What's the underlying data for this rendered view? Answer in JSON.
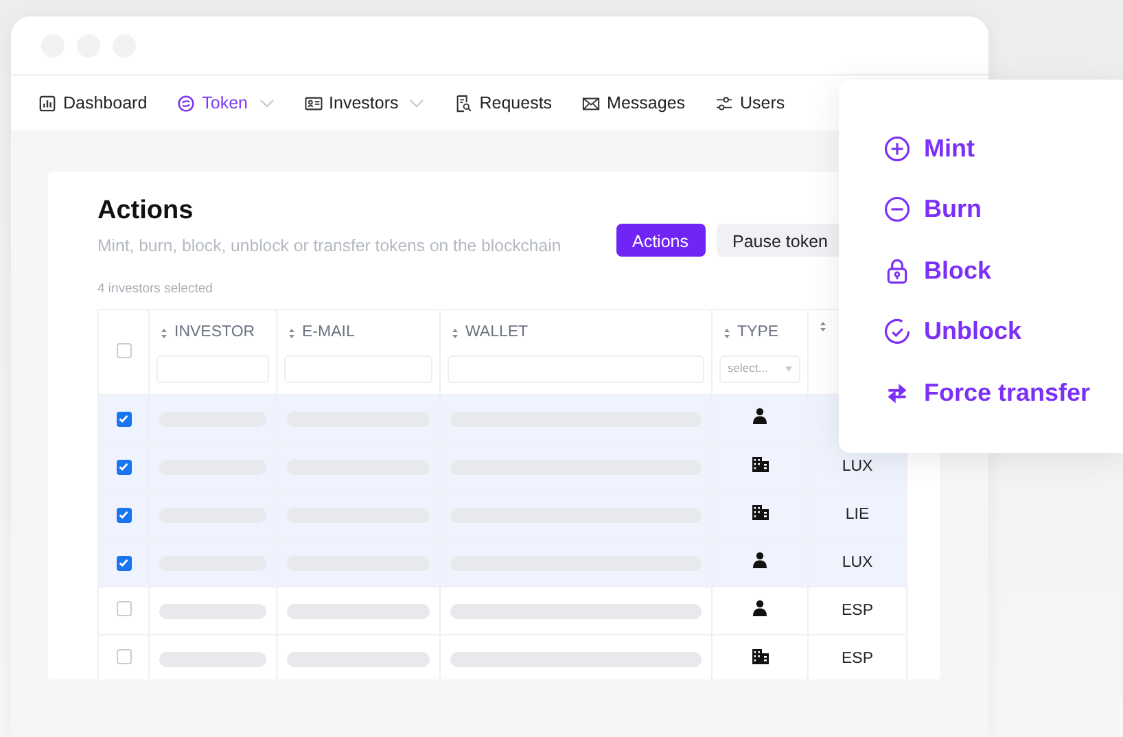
{
  "nav": [
    {
      "label": "Dashboard",
      "kind": "chart",
      "selected": false,
      "has_menu": false
    },
    {
      "label": "Token",
      "kind": "token",
      "selected": true,
      "has_menu": true
    },
    {
      "label": "Investors",
      "kind": "card",
      "selected": false,
      "has_menu": true
    },
    {
      "label": "Requests",
      "kind": "doc",
      "selected": false,
      "has_menu": false
    },
    {
      "label": "Messages",
      "kind": "mail",
      "selected": false,
      "has_menu": false
    },
    {
      "label": "Users",
      "kind": "sliders",
      "selected": false,
      "has_menu": false
    }
  ],
  "panel": {
    "title": "Actions",
    "subtitle": "Mint, burn, block, unblock or transfer tokens on the blockchain",
    "selection_note": "4 investors selected",
    "buttons": [
      {
        "label": "Actions",
        "kind": "primary"
      },
      {
        "label": "Pause token",
        "kind": "secondary"
      }
    ]
  },
  "table": {
    "select_all": {
      "checked": false
    },
    "columns": [
      {
        "label": "INVESTOR",
        "kind": "text"
      },
      {
        "label": "E-MAIL",
        "kind": "text"
      },
      {
        "label": "WALLET",
        "kind": "text"
      },
      {
        "label": "TYPE",
        "kind": "select",
        "placeholder": "select..."
      },
      {
        "kind": "none"
      }
    ],
    "rows": [
      {
        "selected": true,
        "kind": "person"
      },
      {
        "selected": true,
        "kind": "company",
        "country": "LUX"
      },
      {
        "selected": true,
        "kind": "company",
        "country": "LIE"
      },
      {
        "selected": true,
        "kind": "person",
        "country": "LUX"
      },
      {
        "selected": false,
        "kind": "person",
        "country": "ESP"
      },
      {
        "selected": false,
        "kind": "company",
        "country": "ESP"
      }
    ]
  },
  "menu": [
    {
      "label": "Mint",
      "kind": "plus"
    },
    {
      "label": "Burn",
      "kind": "minus"
    },
    {
      "label": "Block",
      "kind": "lock"
    },
    {
      "label": "Unblock",
      "kind": "check"
    },
    {
      "label": "Force transfer",
      "kind": "swap"
    }
  ]
}
